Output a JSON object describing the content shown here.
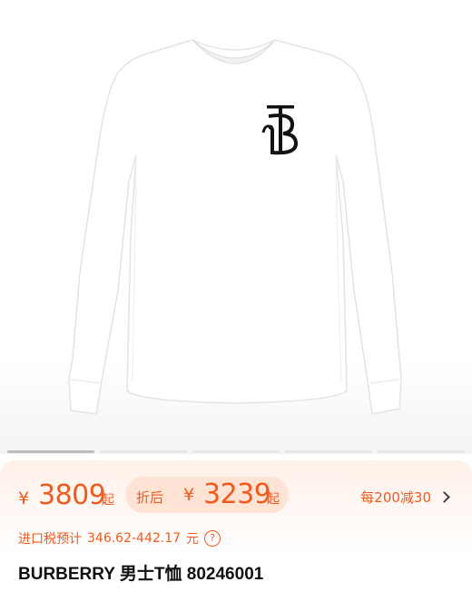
{
  "product": {
    "image_alt": "white long-sleeve t-shirt",
    "logo_letters": "TB",
    "gallery_pages": 5,
    "gallery_active": 1
  },
  "pricing": {
    "currency_symbol": "¥",
    "price": "3809",
    "price_unit": "起",
    "discount_label": "折后",
    "discount_price": "3239",
    "discount_unit": "起",
    "promo_text": "每200减30"
  },
  "tax": {
    "label": "进口税预计",
    "range": "346.62-442.17",
    "unit": "元",
    "help": "?"
  },
  "title": "BURBERRY 男士T恤 80246001",
  "colors": {
    "accent": "#f15a1c",
    "pill_bg": "#ffe3d4"
  }
}
